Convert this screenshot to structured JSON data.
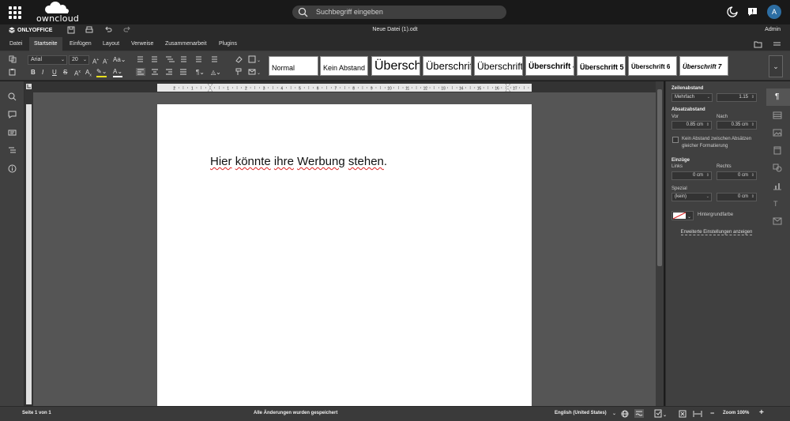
{
  "oc_header": {
    "logo_text": "owncloud",
    "search_placeholder": "Suchbegriff eingeben",
    "avatar_initial": "A"
  },
  "oo_title": {
    "brand": "ONLYOFFICE",
    "document_title": "Neue Datei (1).odt",
    "user": "Admin"
  },
  "tabs": [
    "Datei",
    "Startseite",
    "Einfügen",
    "Layout",
    "Verweise",
    "Zusammenarbeit",
    "Plugins"
  ],
  "active_tab": "Startseite",
  "toolbar": {
    "font_name": "Arial",
    "font_size": "20",
    "styles": [
      "Normal",
      "Kein Abstand",
      "Überschrift 1",
      "Überschrift 2",
      "Überschrift 3",
      "Überschrift 4",
      "Überschrift 5",
      "Überschrift 6",
      "Überschrift 7"
    ]
  },
  "document": {
    "words": [
      "Hier",
      "könnte",
      "ihre",
      "Werbung",
      "stehen"
    ],
    "trailing": "."
  },
  "ruler_numbers": [
    "2",
    "1",
    "1",
    "2",
    "3",
    "4",
    "5",
    "6",
    "7",
    "8",
    "9",
    "10",
    "11",
    "12",
    "13",
    "14",
    "15",
    "16",
    "17"
  ],
  "paragraph_panel": {
    "line_spacing_heading": "Zeilenabstand",
    "line_spacing_mode": "Mehrfach",
    "line_spacing_value": "1.15",
    "spacing_heading": "Absatzabstand",
    "before_label": "Vor",
    "before_value": "0.85 cm",
    "after_label": "Nach",
    "after_value": "0.35 cm",
    "no_space_label": "Kein Abstand zwischen Absätzen gleicher Formatierung",
    "indent_heading": "Einzüge",
    "left_label": "Links",
    "left_value": "0 cm",
    "right_label": "Rechts",
    "right_value": "0 cm",
    "special_label": "Spezial",
    "special_value": "(kein)",
    "special_amount": "0 cm",
    "bg_label": "Hintergrundfarbe",
    "advanced_link": "Erweiterte Einstellungen anzeigen"
  },
  "status_bar": {
    "page": "Seite 1 von 1",
    "save_state": "Alle Änderungen wurden gespeichert",
    "language": "English (United States)",
    "zoom": "Zoom 100%"
  },
  "colors": {
    "accent_avatar": "#2d6ea3",
    "panel": "#404040",
    "canvas": "#555555"
  }
}
